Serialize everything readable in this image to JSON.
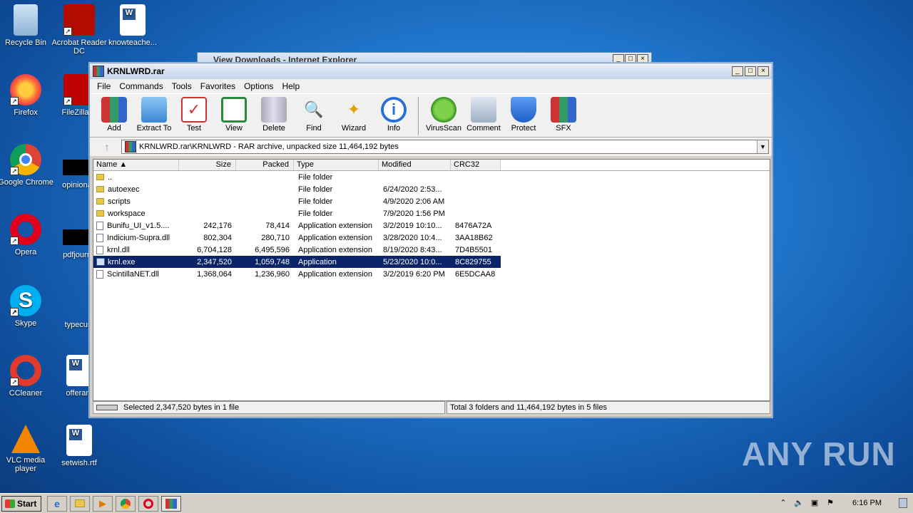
{
  "desktop": {
    "icons": [
      {
        "label": "Recycle Bin"
      },
      {
        "label": "Acrobat Reader DC"
      },
      {
        "label": "knowteache..."
      },
      {
        "label": "Firefox"
      },
      {
        "label": "FileZilla C"
      },
      {
        "label": "Google Chrome"
      },
      {
        "label": "opinionau"
      },
      {
        "label": "Opera"
      },
      {
        "label": "pdfjourna"
      },
      {
        "label": "Skype"
      },
      {
        "label": "typecust"
      },
      {
        "label": "CCleaner"
      },
      {
        "label": "offerant"
      },
      {
        "label": "VLC media player"
      },
      {
        "label": "setwish.rtf"
      }
    ],
    "watermark": "ANY RUN"
  },
  "bg_window": {
    "title": "View Downloads - Internet Explorer"
  },
  "window": {
    "title": "KRNLWRD.rar",
    "menu": [
      "File",
      "Commands",
      "Tools",
      "Favorites",
      "Options",
      "Help"
    ],
    "toolbar": [
      {
        "label": "Add",
        "icon": "add-icon"
      },
      {
        "label": "Extract To",
        "icon": "extract-icon"
      },
      {
        "label": "Test",
        "icon": "test-icon"
      },
      {
        "label": "View",
        "icon": "view-icon"
      },
      {
        "label": "Delete",
        "icon": "delete-icon"
      },
      {
        "label": "Find",
        "icon": "find-icon"
      },
      {
        "label": "Wizard",
        "icon": "wizard-icon"
      },
      {
        "label": "Info",
        "icon": "info-icon"
      },
      {
        "label": "VirusScan",
        "icon": "virusscan-icon"
      },
      {
        "label": "Comment",
        "icon": "comment-icon"
      },
      {
        "label": "Protect",
        "icon": "protect-icon"
      },
      {
        "label": "SFX",
        "icon": "sfx-icon"
      }
    ],
    "address": "KRNLWRD.rar\\KRNLWRD - RAR archive, unpacked size 11,464,192 bytes",
    "columns": [
      "Name",
      "Size",
      "Packed",
      "Type",
      "Modified",
      "CRC32"
    ],
    "rows": [
      {
        "name": "..",
        "size": "",
        "packed": "",
        "type": "File folder",
        "modified": "",
        "crc": "",
        "kind": "folder"
      },
      {
        "name": "autoexec",
        "size": "",
        "packed": "",
        "type": "File folder",
        "modified": "6/24/2020 2:53...",
        "crc": "",
        "kind": "folder"
      },
      {
        "name": "scripts",
        "size": "",
        "packed": "",
        "type": "File folder",
        "modified": "4/9/2020 2:06 AM",
        "crc": "",
        "kind": "folder"
      },
      {
        "name": "workspace",
        "size": "",
        "packed": "",
        "type": "File folder",
        "modified": "7/9/2020 1:56 PM",
        "crc": "",
        "kind": "folder"
      },
      {
        "name": "Bunifu_UI_v1.5....",
        "size": "242,176",
        "packed": "78,414",
        "type": "Application extension",
        "modified": "3/2/2019 10:10...",
        "crc": "8476A72A",
        "kind": "file"
      },
      {
        "name": "Indicium-Supra.dll",
        "size": "802,304",
        "packed": "280,710",
        "type": "Application extension",
        "modified": "3/28/2020 10:4...",
        "crc": "3AA18B62",
        "kind": "file"
      },
      {
        "name": "krnl.dll",
        "size": "6,704,128",
        "packed": "6,495,596",
        "type": "Application extension",
        "modified": "8/19/2020 8:43...",
        "crc": "7D4B5501",
        "kind": "file"
      },
      {
        "name": "krnl.exe",
        "size": "2,347,520",
        "packed": "1,059,748",
        "type": "Application",
        "modified": "5/23/2020 10:0...",
        "crc": "8C829755",
        "kind": "exe",
        "selected": true
      },
      {
        "name": "ScintillaNET.dll",
        "size": "1,368,064",
        "packed": "1,236,960",
        "type": "Application extension",
        "modified": "3/2/2019 6:20 PM",
        "crc": "6E5DCAA8",
        "kind": "file"
      }
    ],
    "status_left": "Selected 2,347,520 bytes in 1 file",
    "status_right": "Total 3 folders and 11,464,192 bytes in 5 files"
  },
  "taskbar": {
    "start_label": "Start",
    "clock": "6:16 PM"
  }
}
